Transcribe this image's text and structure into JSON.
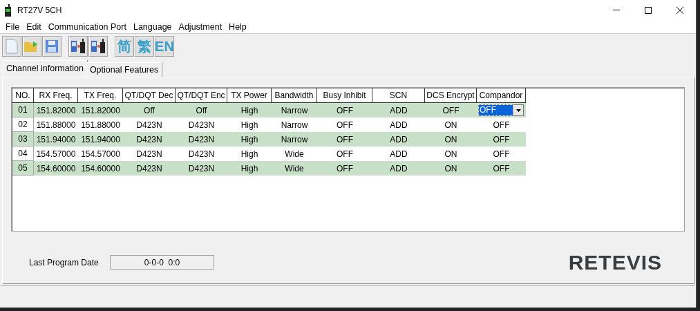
{
  "window": {
    "title": "RT27V 5CH"
  },
  "menu": [
    "File",
    "Edit",
    "Communication Port",
    "Language",
    "Adjustment",
    "Help"
  ],
  "toolbar": [
    {
      "kind": "new"
    },
    {
      "kind": "open"
    },
    {
      "kind": "save"
    },
    {
      "kind": "read"
    },
    {
      "kind": "write"
    },
    {
      "kind": "text",
      "label": "简"
    },
    {
      "kind": "text",
      "label": "繁"
    },
    {
      "kind": "text",
      "label": "EN"
    }
  ],
  "tabs": [
    {
      "label": "Channel information",
      "selected": true
    },
    {
      "label": "Optional Features",
      "selected": false
    }
  ],
  "table": {
    "columns": [
      "NO.",
      "RX Freq.",
      "TX Freq.",
      "QT/DQT Dec",
      "QT/DQT Enc",
      "TX Power",
      "Bandwidth",
      "Busy Inhibit",
      "SCN",
      "DCS Encrypt",
      "Compandor"
    ],
    "rows": [
      {
        "cells": [
          "01",
          "151.82000",
          "151.82000",
          "Off",
          "Off",
          "High",
          "Narrow",
          "OFF",
          "ADD",
          "OFF",
          "OFF"
        ],
        "editing": true
      },
      {
        "cells": [
          "02",
          "151.88000",
          "151.88000",
          "D423N",
          "D423N",
          "High",
          "Narrow",
          "OFF",
          "ADD",
          "ON",
          "OFF"
        ],
        "editing": false
      },
      {
        "cells": [
          "03",
          "151.94000",
          "151.94000",
          "D423N",
          "D423N",
          "High",
          "Narrow",
          "OFF",
          "ADD",
          "ON",
          "OFF"
        ],
        "editing": false
      },
      {
        "cells": [
          "04",
          "154.57000",
          "154.57000",
          "D423N",
          "D423N",
          "High",
          "Wide",
          "OFF",
          "ADD",
          "ON",
          "OFF"
        ],
        "editing": false
      },
      {
        "cells": [
          "05",
          "154.60000",
          "154.60000",
          "D423N",
          "D423N",
          "High",
          "Wide",
          "OFF",
          "ADD",
          "ON",
          "OFF"
        ],
        "editing": false
      }
    ]
  },
  "last_program": {
    "label": "Last Program Date",
    "value": "0-0-0  0:0"
  },
  "logo": "RETEVIS"
}
